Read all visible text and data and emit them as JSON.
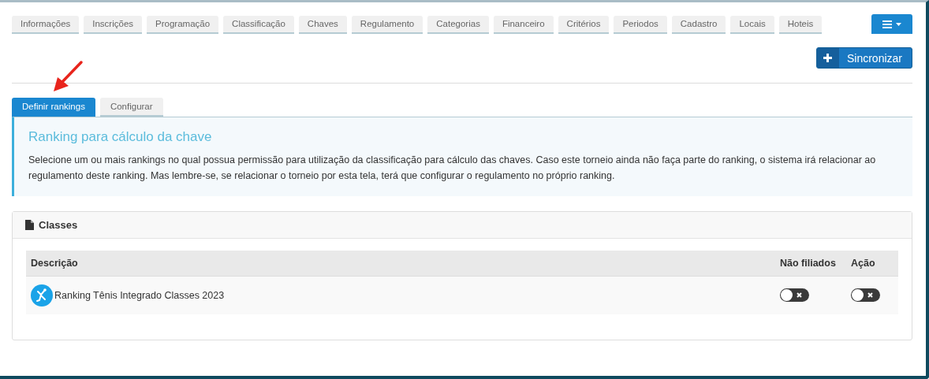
{
  "main_tabs": [
    {
      "label": "Informações",
      "selected": false
    },
    {
      "label": "Inscrições",
      "selected": false
    },
    {
      "label": "Programação",
      "selected": false
    },
    {
      "label": "Classificação",
      "selected": false
    },
    {
      "label": "Chaves",
      "selected": false
    },
    {
      "label": "Regulamento",
      "selected": false
    },
    {
      "label": "Categorias",
      "selected": false
    },
    {
      "label": "Financeiro",
      "selected": false
    },
    {
      "label": "Critérios",
      "selected": false
    },
    {
      "label": "Periodos",
      "selected": false
    },
    {
      "label": "Cadastro",
      "selected": false
    },
    {
      "label": "Locais",
      "selected": false
    },
    {
      "label": "Hoteis",
      "selected": false
    }
  ],
  "sync_button": {
    "label": "Sincronizar"
  },
  "sub_tabs": [
    {
      "label": "Definir rankings",
      "selected": true
    },
    {
      "label": "Configurar",
      "selected": false
    }
  ],
  "callout": {
    "title": "Ranking para cálculo da chave",
    "text": "Selecione um ou mais rankings no qual possua permissão para utilização da classificação para cálculo das chaves. Caso este torneio ainda não faça parte do ranking, o sistema irá relacionar ao regulamento deste ranking. Mas lembre-se, se relacionar o torneio por esta tela, terá que configurar o regulamento no próprio ranking."
  },
  "panel": {
    "title": "Classes",
    "table": {
      "columns": [
        "Descrição",
        "Não filiados",
        "Ação"
      ],
      "rows": [
        {
          "description": "Ranking Tênis Integrado Classes 2023",
          "nao_filiados": {
            "on": false
          },
          "acao": {
            "on": false
          }
        }
      ]
    }
  }
}
